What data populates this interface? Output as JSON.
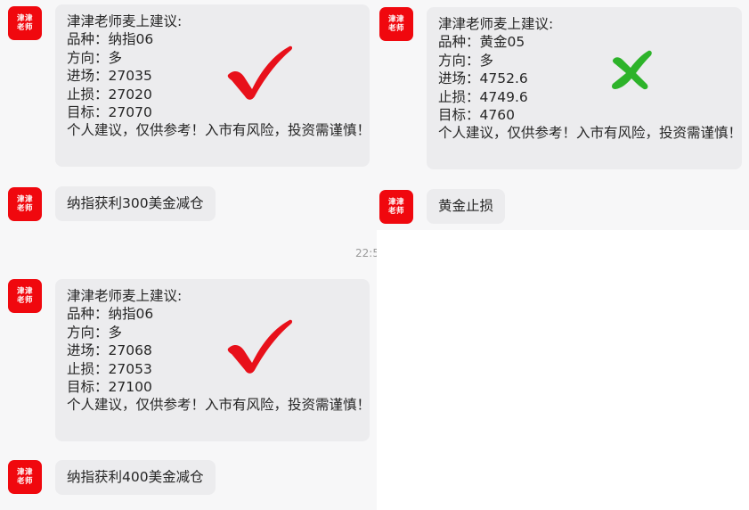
{
  "avatar": {
    "line1": "津津",
    "line2": "老师"
  },
  "cards": [
    {
      "id": "nasdaq-1",
      "lines": [
        "津津老师麦上建议:",
        "品种：纳指06",
        "方向：多",
        "进场：27035",
        "止损：27020",
        "目标：27070",
        "个人建议，仅供参考！入市有风险，投资需谨慎！"
      ],
      "result": "checkmark",
      "result_color": "#e8101a",
      "followup": "纳指获利300美金减仓"
    },
    {
      "id": "gold-1",
      "lines": [
        "津津老师麦上建议:",
        "品种：黄金05",
        "方向：多",
        "进场：4752.6",
        "止损：4749.6",
        "目标：4760",
        "个人建议，仅供参考！入市有风险，投资需谨慎！"
      ],
      "result": "cross",
      "result_color": "#2db32a",
      "followup": "黄金止损"
    },
    {
      "id": "nasdaq-2",
      "lines": [
        "津津老师麦上建议:",
        "品种：纳指06",
        "方向：多",
        "进场：27068",
        "止损：27053",
        "目标：27100",
        "个人建议，仅供参考！入市有风险，投资需谨慎！"
      ],
      "result": "checkmark",
      "result_color": "#e8101a",
      "followup": "纳指获利400美金减仓"
    }
  ],
  "timestamp": "22:5"
}
